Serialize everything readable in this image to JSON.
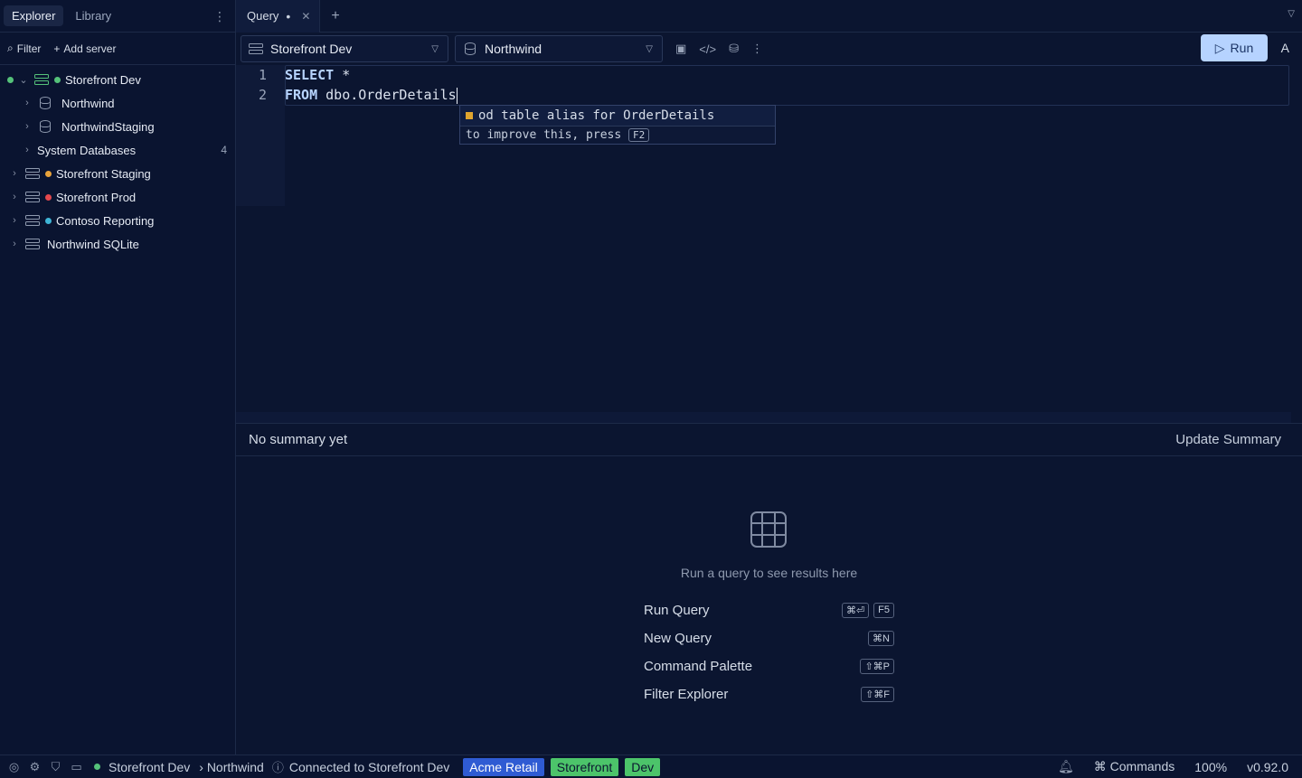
{
  "sidebar": {
    "tabs": [
      "Explorer",
      "Library"
    ],
    "filter_label": "Filter",
    "add_server_label": "Add server",
    "tree": {
      "storefront_dev": "Storefront Dev",
      "northwind": "Northwind",
      "northwind_staging": "NorthwindStaging",
      "system_databases": "System Databases",
      "system_databases_count": "4",
      "storefront_staging": "Storefront Staging",
      "storefront_prod": "Storefront Prod",
      "contoso_reporting": "Contoso Reporting",
      "northwind_sqlite": "Northwind SQLite"
    }
  },
  "tabs": {
    "query_label": "Query"
  },
  "toolbar": {
    "connection": "Storefront Dev",
    "database": "Northwind",
    "run_label": "Run",
    "extra": "A"
  },
  "editor": {
    "line_numbers": [
      "1",
      "2"
    ],
    "line1_kw": "SELECT",
    "line1_rest": " *",
    "line2_kw": "FROM",
    "line2_rest": " dbo.OrderDetails",
    "suggestion_text": "od  table alias for OrderDetails",
    "suggestion_hint": "to improve this, press",
    "suggestion_key": "F2"
  },
  "summary": {
    "text": "No summary yet",
    "update_label": "Update Summary"
  },
  "results": {
    "empty_message": "Run a query to see results here",
    "shortcuts": [
      {
        "label": "Run Query",
        "keys": [
          "⌘⏎",
          "F5"
        ]
      },
      {
        "label": "New Query",
        "keys": [
          "⌘N"
        ]
      },
      {
        "label": "Command Palette",
        "keys": [
          "⇧⌘P"
        ]
      },
      {
        "label": "Filter Explorer",
        "keys": [
          "⇧⌘F"
        ]
      }
    ]
  },
  "status": {
    "connection": "Storefront Dev",
    "database": "› Northwind",
    "connected_text": "Connected to Storefront Dev",
    "badges": [
      {
        "label": "Acme Retail",
        "color": "#2f5bd3",
        "text_color": "#ffffff"
      },
      {
        "label": "Storefront",
        "color": "#4cc46a",
        "text_color": "#0b1530"
      },
      {
        "label": "Dev",
        "color": "#4cc46a",
        "text_color": "#0b1530"
      }
    ],
    "commands_label": "Commands",
    "zoom": "100%",
    "version": "v0.92.0"
  },
  "colors": {
    "green": "#55c27a",
    "orange": "#e8a33b",
    "red": "#e5484d",
    "cyan": "#3fb5d6"
  }
}
